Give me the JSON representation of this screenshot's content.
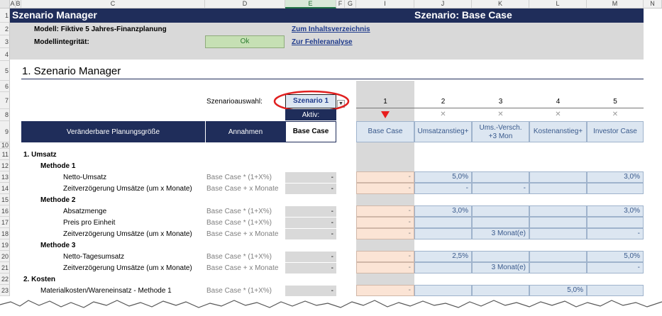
{
  "columns": [
    "A",
    "B",
    "C",
    "D",
    "E",
    "F",
    "G",
    "I",
    "J",
    "K",
    "L",
    "M",
    "N"
  ],
  "rows": [
    "1",
    "2",
    "3",
    "4",
    "5",
    "6",
    "7",
    "8",
    "9",
    "10",
    "11",
    "12",
    "13",
    "14",
    "15",
    "16",
    "17",
    "18",
    "19",
    "20",
    "21",
    "22",
    "23"
  ],
  "title_bar": {
    "left": "Szenario Manager",
    "right": "Szenario: Base Case"
  },
  "info": {
    "model_label": "Modell: Fiktive 5 Jahres-Finanzplanung",
    "integrity_label": "Modellintegrität:",
    "integrity_value": "Ok",
    "link_toc": "Zum Inhaltsverzeichnis",
    "link_errors": "Zur Fehleranalyse"
  },
  "section_title": "1. Szenario Manager",
  "selector": {
    "label": "Szenarioauswahl:",
    "value": "Szenario 1",
    "active_label": "Aktiv:"
  },
  "scenario_numbers": [
    "1",
    "2",
    "3",
    "4",
    "5"
  ],
  "table_headers": {
    "variable": "Veränderbare Planungsgröße",
    "assumptions": "Annahmen",
    "base": "Base Case",
    "scenarios": [
      "Base Case",
      "Umsatzanstieg+",
      "Ums.-Versch.\n+3 Mon",
      "Kostenanstieg+",
      "Investor Case"
    ]
  },
  "body_rows": [
    {
      "row": "11",
      "label": "1.   Umsatz",
      "bold": true,
      "indent": 0
    },
    {
      "row": "12",
      "label": "Methode 1",
      "bold": true,
      "indent": 1
    },
    {
      "row": "13",
      "label": "Netto-Umsatz",
      "indent": 2,
      "annahme": "Base Case * (1+X%)",
      "base": "-",
      "s": [
        "-",
        "5,0%",
        "",
        "",
        "3,0%"
      ]
    },
    {
      "row": "14",
      "label": "Zeitverzögerung Umsätze (um x Monate)",
      "indent": 2,
      "annahme": "Base Case + x Monate",
      "base": "-",
      "s": [
        "-",
        "-",
        "-",
        "",
        ""
      ]
    },
    {
      "row": "15",
      "label": "Methode 2",
      "bold": true,
      "indent": 1
    },
    {
      "row": "16",
      "label": "Absatzmenge",
      "indent": 2,
      "annahme": "Base Case * (1+X%)",
      "base": "-",
      "s": [
        "-",
        "3,0%",
        "",
        "",
        "3,0%"
      ]
    },
    {
      "row": "17",
      "label": "Preis pro Einheit",
      "indent": 2,
      "annahme": "Base Case * (1+X%)",
      "base": "-",
      "s": [
        "-",
        "",
        "",
        "",
        ""
      ]
    },
    {
      "row": "18",
      "label": "Zeitverzögerung Umsätze (um x Monate)",
      "indent": 2,
      "annahme": "Base Case + x Monate",
      "base": "-",
      "s": [
        "-",
        "",
        "3 Monat(e)",
        "",
        "-"
      ]
    },
    {
      "row": "19",
      "label": "Methode 3",
      "bold": true,
      "indent": 1
    },
    {
      "row": "20",
      "label": "Netto-Tagesumsatz",
      "indent": 2,
      "annahme": "Base Case * (1+X%)",
      "base": "-",
      "s": [
        "-",
        "2,5%",
        "",
        "",
        "5,0%"
      ]
    },
    {
      "row": "21",
      "label": "Zeitverzögerung Umsätze (um x Monate)",
      "indent": 2,
      "annahme": "Base Case + x Monate",
      "base": "-",
      "s": [
        "-",
        "",
        "3 Monat(e)",
        "",
        "-"
      ]
    },
    {
      "row": "22",
      "label": "2.   Kosten",
      "bold": true,
      "indent": 0
    },
    {
      "row": "23",
      "label": "Materialkosten/Wareneinsatz - Methode 1",
      "indent": 1,
      "annahme": "Base Case * (1+X%)",
      "base": "-",
      "s": [
        "-",
        "",
        "",
        "5,0%",
        ""
      ]
    }
  ],
  "colors": {
    "navy": "#1f2d5a",
    "header_blue": "#dce6f1",
    "peach": "#fbe4d5",
    "gray": "#d9d9d9",
    "marker_red": "#e81e1e",
    "highlight_ellipse": "#e02020"
  }
}
